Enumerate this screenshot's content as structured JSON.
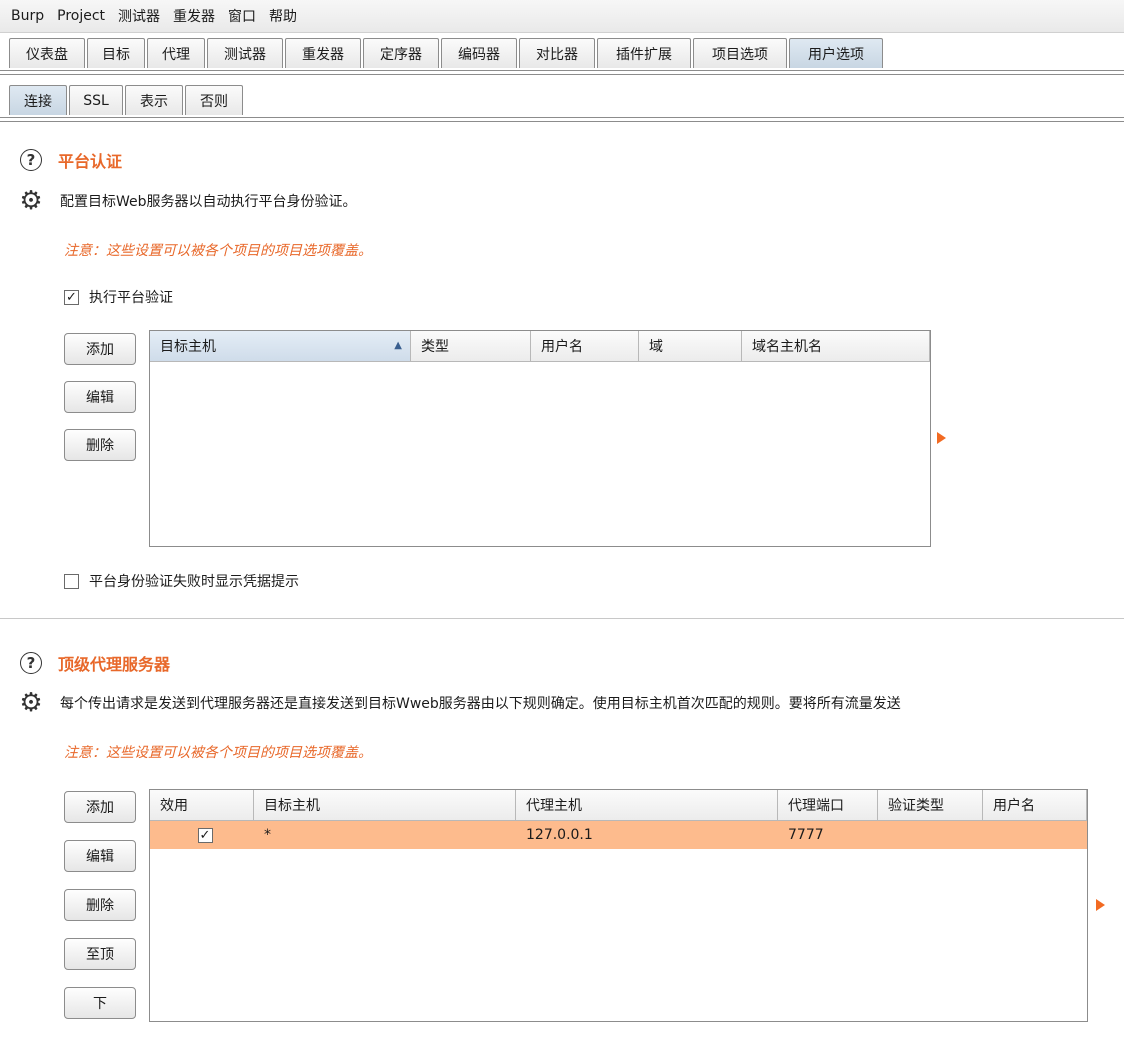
{
  "menubar": {
    "items": [
      "Burp",
      "Project",
      "测试器",
      "重发器",
      "窗口",
      "帮助"
    ]
  },
  "main_tabs": [
    "仪表盘",
    "目标",
    "代理",
    "测试器",
    "重发器",
    "定序器",
    "编码器",
    "对比器",
    "插件扩展",
    "项目选项",
    "用户选项"
  ],
  "main_tabs_active": "用户选项",
  "sub_tabs": [
    "连接",
    "SSL",
    "表示",
    "否则"
  ],
  "sub_tabs_active": "连接",
  "platform_auth": {
    "title": "平台认证",
    "description": "配置目标Web服务器以自动执行平台身份验证。",
    "note": "注意：这些设置可以被各个项目的项目选项覆盖。",
    "enable_label": "执行平台验证",
    "enable_checked": true,
    "buttons": {
      "add": "添加",
      "edit": "编辑",
      "remove": "删除"
    },
    "columns": [
      "目标主机",
      "类型",
      "用户名",
      "域",
      "域名主机名"
    ],
    "prompt_label": "平台身份验证失败时显示凭据提示",
    "prompt_checked": false
  },
  "upstream_proxy": {
    "title": "顶级代理服务器",
    "description": "每个传出请求是发送到代理服务器还是直接发送到目标Wweb服务器由以下规则确定。使用目标主机首次匹配的规则。要将所有流量发送",
    "note": "注意：这些设置可以被各个项目的项目选项覆盖。",
    "buttons": {
      "add": "添加",
      "edit": "编辑",
      "remove": "删除",
      "top": "至顶",
      "down": "下"
    },
    "columns": [
      "效用",
      "目标主机",
      "代理主机",
      "代理端口",
      "验证类型",
      "用户名"
    ],
    "rows": [
      {
        "enabled": true,
        "check": "✓",
        "target": "*",
        "proxy_host": "127.0.0.1",
        "proxy_port": "7777",
        "auth_type": "",
        "username": ""
      }
    ]
  },
  "colors": {
    "accent": "#e8682a",
    "selected_row": "#fdbb8d",
    "arrow": "#f26a22"
  }
}
